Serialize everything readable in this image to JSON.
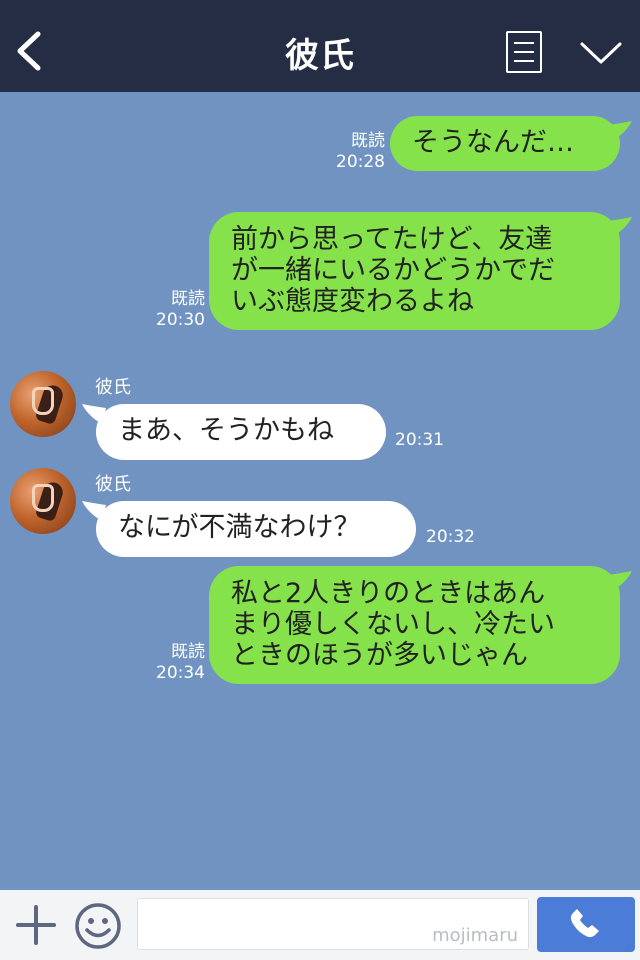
{
  "header": {
    "title": "彼氏",
    "back_icon": "chevron-left-icon",
    "menu_icon": "notes-icon",
    "dropdown_icon": "chevron-down-icon"
  },
  "colors": {
    "header_bg": "#252d45",
    "chat_bg": "#7193c1",
    "my_bubble": "#85e24a",
    "their_bubble": "#ffffff",
    "call_button": "#4a7cd8"
  },
  "messages": [
    {
      "from": "me",
      "read_label": "既読",
      "time": "20:28",
      "text": "そうなんだ…"
    },
    {
      "from": "me",
      "read_label": "既読",
      "time": "20:30",
      "lines": [
        "前から思ってたけど、友達",
        "が一緒にいるかどうかでだ",
        "いぶ態度変わるよね"
      ]
    },
    {
      "from": "them",
      "sender": "彼氏",
      "time": "20:31",
      "text": "まあ、そうかもね"
    },
    {
      "from": "them",
      "sender": "彼氏",
      "time": "20:32",
      "text": "なにが不満なわけ？"
    },
    {
      "from": "me",
      "read_label": "既読",
      "time": "20:34",
      "lines": [
        "私と2人きりのときはあん",
        "まり優しくないし、冷たい",
        "ときのほうが多いじゃん"
      ]
    }
  ],
  "input_bar": {
    "plus_icon": "plus-icon",
    "emoji_icon": "smiley-icon",
    "watermark": "mojimaru",
    "call_icon": "phone-icon"
  }
}
